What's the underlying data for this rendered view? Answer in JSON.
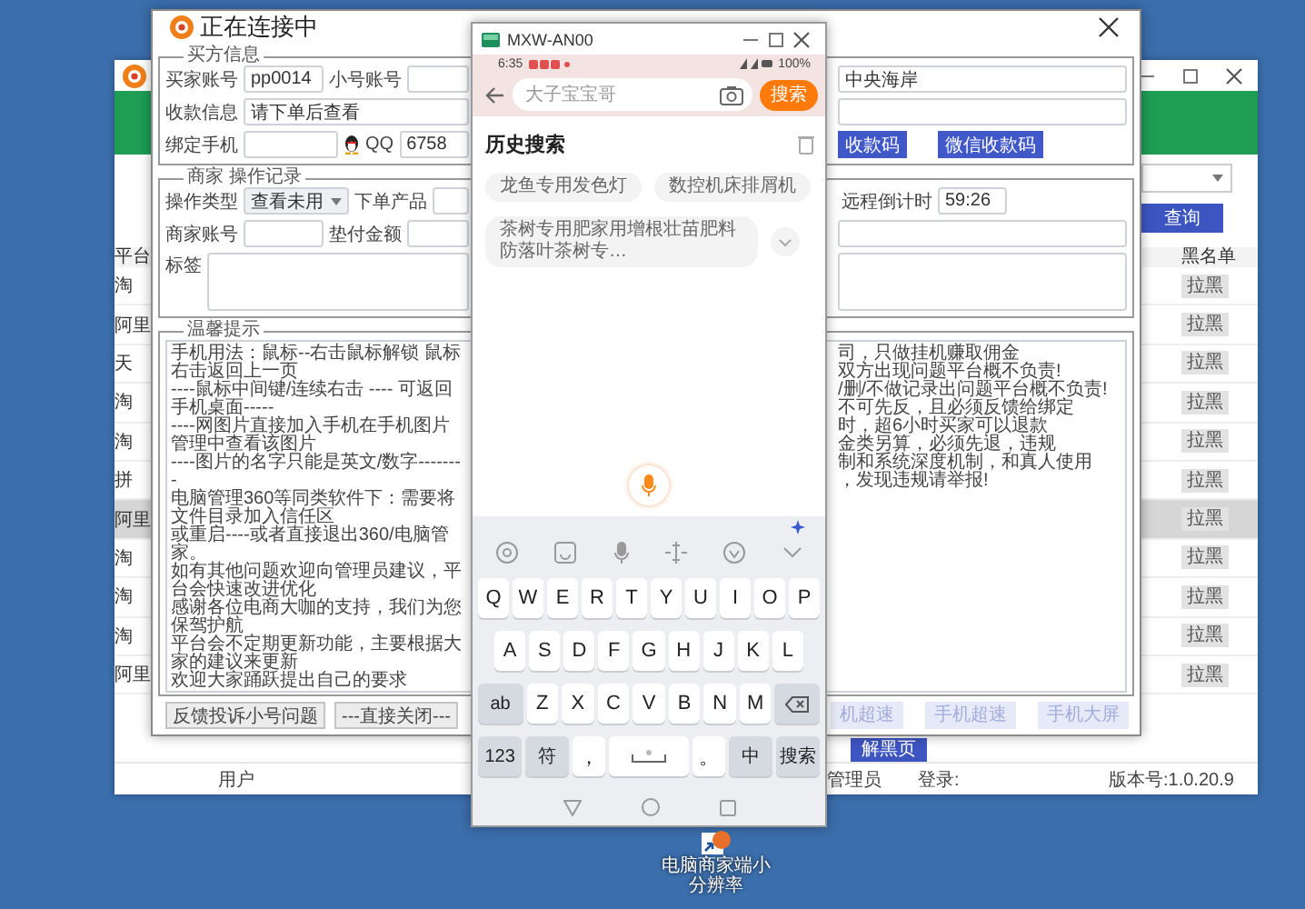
{
  "main_window": {
    "platform_header": "平台",
    "blacklist_header": "黑名单",
    "query_button": "查询",
    "rows": [
      {
        "platform": "淘",
        "button": "拉黑",
        "selected": false
      },
      {
        "platform": "阿里",
        "button": "拉黑",
        "selected": false
      },
      {
        "platform": "天",
        "button": "拉黑",
        "selected": false
      },
      {
        "platform": "淘",
        "button": "拉黑",
        "selected": false
      },
      {
        "platform": "淘",
        "button": "拉黑",
        "selected": false
      },
      {
        "platform": "拼",
        "button": "拉黑",
        "selected": false
      },
      {
        "platform": "阿里",
        "button": "拉黑",
        "selected": true
      },
      {
        "platform": "淘",
        "button": "拉黑",
        "selected": false
      },
      {
        "platform": "淘",
        "button": "拉黑",
        "selected": false
      },
      {
        "platform": "淘",
        "button": "拉黑",
        "selected": false
      },
      {
        "platform": "阿里",
        "button": "拉黑",
        "selected": false
      }
    ],
    "bottom_button": "解黑页",
    "status_bar": {
      "user": "用户",
      "admin": "管理员",
      "login": "登录:",
      "version": "版本号:1.0.20.9"
    }
  },
  "dialog": {
    "title": "正在连接中",
    "buyer_group": {
      "legend": "买方信息",
      "buyer_account_label": "买家账号",
      "buyer_account": "pp0014",
      "alt_account_label": "小号账号",
      "address": "中央海岸",
      "payment_label": "收款信息",
      "payment_value": "请下单后查看",
      "phone_label": "绑定手机",
      "qq_label": "QQ",
      "qq_value": "6758",
      "buttons": [
        "收款码",
        "微信收款码"
      ]
    },
    "merchant_group": {
      "legend": "商家 操作记录",
      "op_type_label": "操作类型",
      "op_type": "查看未用",
      "product_label": "下单产品",
      "countdown_label": "远程倒计时",
      "countdown": "59:26",
      "merchant_account_label": "商家账号",
      "advance_label": "垫付金额",
      "tag_label": "标签"
    },
    "notes_group": {
      "legend": "温馨提示",
      "lines_left": [
        "手机用法：鼠标--右击鼠标解锁 鼠标右击返回上一页",
        "----鼠标中间键/连续右击 ---- 可返回手机桌面-----",
        "----网图片直接加入手机在手机图片管理中查看该图片",
        "----图片的名字只能是英文/数字--------",
        "电脑管理360等同类软件下：需要将文件目录加入信任区",
        "或重启----或者直接退出360/电脑管家。",
        "如有其他问题欢迎向管理员建议，平台会快速改进优化",
        "感谢各位电商大咖的支持，我们为您保驾护航",
        "平台会不定期更新功能，主要根据大家的建议来更新",
        "欢迎大家踊跃提出自己的要求"
      ],
      "lines_right": [
        "司，只做挂机赚取佣金",
        "双方出现问题平台概不负责!",
        "/删/不做记录出问题平台概不负责!",
        "不可先反，且必须反馈给绑定",
        "时，超6小时买家可以退款",
        "金类另算，必须先退，违规",
        "制和系统深度机制，和真人使用",
        "，发现违规请举报!"
      ]
    },
    "left_buttons": [
      "反馈投诉小号问题",
      "---直接关闭---"
    ],
    "right_buttons": [
      {
        "label": "机超速",
        "disabled": true
      },
      {
        "label": "手机超速",
        "disabled": true
      },
      {
        "label": "手机大屏",
        "disabled": true
      }
    ]
  },
  "phone": {
    "title": "MXW-AN00",
    "time": "6:35",
    "battery": "100%",
    "search_placeholder": "大子宝宝哥",
    "search_button": "搜索",
    "history_title": "历史搜索",
    "history": [
      "龙鱼专用发色灯",
      "数控机床排屑机",
      "茶树专用肥家用增根壮苗肥料防落叶茶树专…"
    ],
    "keyboard": [
      [
        {
          "kind": "letter",
          "label": "Q"
        },
        {
          "kind": "letter",
          "label": "W"
        },
        {
          "kind": "letter",
          "label": "E"
        },
        {
          "kind": "letter",
          "label": "R"
        },
        {
          "kind": "letter",
          "label": "T"
        },
        {
          "kind": "letter",
          "label": "Y"
        },
        {
          "kind": "letter",
          "label": "U"
        },
        {
          "kind": "letter",
          "label": "I"
        },
        {
          "kind": "letter",
          "label": "O"
        },
        {
          "kind": "letter",
          "label": "P"
        }
      ],
      [
        {
          "kind": "letter",
          "label": "A"
        },
        {
          "kind": "letter",
          "label": "S"
        },
        {
          "kind": "letter",
          "label": "D"
        },
        {
          "kind": "letter",
          "label": "F"
        },
        {
          "kind": "letter",
          "label": "G"
        },
        {
          "kind": "letter",
          "label": "H"
        },
        {
          "kind": "letter",
          "label": "J"
        },
        {
          "kind": "letter",
          "label": "K"
        },
        {
          "kind": "letter",
          "label": "L"
        }
      ],
      [
        {
          "kind": "func",
          "label": "ab"
        },
        {
          "kind": "letter",
          "label": "Z"
        },
        {
          "kind": "letter",
          "label": "X"
        },
        {
          "kind": "letter",
          "label": "C"
        },
        {
          "kind": "letter",
          "label": "V"
        },
        {
          "kind": "letter",
          "label": "B"
        },
        {
          "kind": "letter",
          "label": "N"
        },
        {
          "kind": "letter",
          "label": "M"
        },
        {
          "kind": "delete"
        }
      ],
      [
        {
          "kind": "func",
          "label": "123"
        },
        {
          "kind": "func",
          "label": "符"
        },
        {
          "kind": "punct",
          "label": "，"
        },
        {
          "kind": "space"
        },
        {
          "kind": "punct",
          "label": "。"
        },
        {
          "kind": "func",
          "label": "中"
        },
        {
          "kind": "func",
          "label": "搜索"
        }
      ]
    ]
  },
  "desktop_icon": {
    "label": "电脑商家端小分辨率"
  }
}
